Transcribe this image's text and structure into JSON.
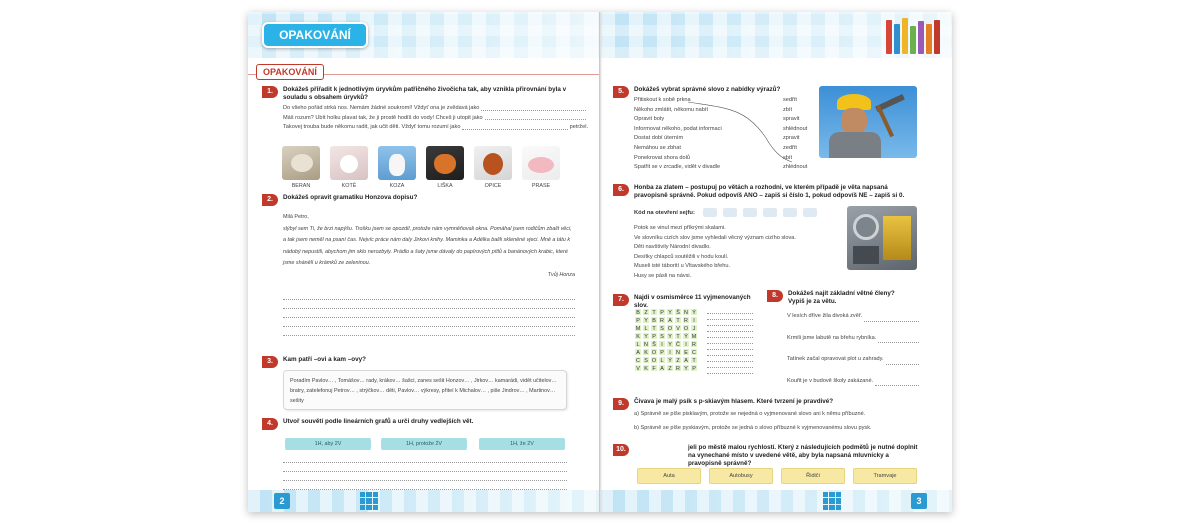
{
  "banner": {
    "title": "OPAKOVÁNÍ"
  },
  "left": {
    "section_tab": "OPAKOVÁNÍ",
    "page_number": "2",
    "q1": {
      "num": "1.",
      "text": "Dokážeš přiřadit k jednotlivým úryvkům patřičného živočicha tak, aby vznikla přirovnání byla v souladu s obsahem úryvků?",
      "sentences": [
        "Do všeho pořád strká nos. Nemám žádné soukromí! Vždyť ona je zvědavá jako",
        "Máš rozum? Ubít holku plavat tak, že ji prostě hodíš do vody! Chceš ji utopit jako",
        "Takovej trouba bude někomu radit, jak učit děti. Vždyť tomu rozumí jako"
      ],
      "sentence3_end": "petržel.",
      "animals": [
        "BERAN",
        "KOTĚ",
        "KOZA",
        "LIŠKA",
        "OPICE",
        "PRASE"
      ]
    },
    "q2": {
      "num": "2.",
      "text": "Dokážeš opravit gramatiku Honzova dopisu?",
      "greeting": "Milá Petro,",
      "letter": "slýbyl sem Ti, že brzi napýšu. Trošku jsem se opozdil, protože nám vymněňovali okna. Pomáhal jsem rodičům zbalit věci, a tak jsem neměl na psaní čas. Nejvíc práce nám daly Jirkovi knihy. Maminka a Adélka balili skleněné vjeci. Mně a tátu k nádobý nepustili, abychom jim sklo nerozbyly. Prádlo a šaty jsme dávaly do papírových pítlů a banánových krabic, které jsme shánělí u krámků ze zeleninou.",
      "signature": "Tvůj Honza"
    },
    "q3": {
      "num": "3.",
      "text": "Kam patří –ovi a kam –ovy?",
      "box": "Poradím Pavlov… , Tomášov… rady, krákov… šašci, zanes sešit Honzov… , Jirkov… kamarádi, vidět učitelov… bratry, zatelefonuj Petrov… , strýčkov… děti, Pavlov… výkresy, přiteí k Michalov… , piše Jindrov… , Martinov… sešity"
    },
    "q4": {
      "num": "4.",
      "text": "Utvoř souvětí podle lineárních grafů a urči druhy vedlejších vět.",
      "pills": [
        "1H, aby 2V",
        "1H, protože 2V",
        "1H, že 2V"
      ]
    }
  },
  "right": {
    "page_number": "3",
    "q5": {
      "num": "5.",
      "text": "Dokážeš vybrat správné slovo z nabídky výrazů?",
      "phrases": [
        "Přitiskout k sobě prkna",
        "Někoho zmlátit, někomu nabít",
        "Opravit boty",
        "Informovat někoho, podat informaci",
        "Dostat dobí úterním",
        "Nemáhou se zbhat",
        "Ponekrovat shora dolů",
        "Spatřit se v zrcadle, vidět v divadle"
      ],
      "words": [
        "sedřít",
        "zbít",
        "spravit",
        "shlédnout",
        "zpravit",
        "zedřít",
        "sbít",
        "zhlédnout"
      ]
    },
    "q6": {
      "num": "6.",
      "text": "Honba za zlatem – postupuj po větách a rozhodni, ve kterém případě je věta napsaná pravopisně správně. Pokud odpovíš ANO – zapiš si číslo 1, pokud odpovíš NE – zapiš si 0.",
      "code_label": "Kód na otevření sejfu:",
      "sentences": [
        "Potok se vinul mezi příkrými skalami.",
        "Ve slovníku cizích slov jsme vyhledali věcný význam cizího slova.",
        "Děti navštívily Národní divadlo.",
        "Desítky chlapců soutěžili v hodu koulí.",
        "Museli isté táborití u Vltavského břehu.",
        "Husy se pásli na návsi."
      ]
    },
    "q7": {
      "num": "7.",
      "text": "Najdi v osmisměrce 11 vyjmenovaných slov.",
      "grid": [
        [
          "B",
          "Z",
          "T",
          "P",
          "Y",
          "Š",
          "N",
          "Ý"
        ],
        [
          "P",
          "Y",
          "B",
          "R",
          "A",
          "T",
          "R",
          "I"
        ],
        [
          "M",
          "L",
          "T",
          "S",
          "O",
          "V",
          "O",
          "J"
        ],
        [
          "K",
          "Y",
          "P",
          "S",
          "Y",
          "T",
          "Ý",
          "M"
        ],
        [
          "L",
          "N",
          "Š",
          "I",
          "Y",
          "Č",
          "I",
          "R"
        ],
        [
          "A",
          "K",
          "O",
          "P",
          "I",
          "N",
          "E",
          "C"
        ],
        [
          "C",
          "S",
          "O",
          "L",
          "Ý",
          "Z",
          "A",
          "T"
        ],
        [
          "V",
          "K",
          "F",
          "A",
          "Z",
          "R",
          "Y",
          "P"
        ]
      ]
    },
    "q8": {
      "num": "8.",
      "text": "Dokážeš najít základní větné členy? Vypiš je za větu.",
      "sentences": [
        "V lesích dříve žila divoká zvěř.",
        "Krmili jsme labutě na břehu rybníka.",
        "Tatínek začal opravovat plot u zahrady.",
        "Kouřit je v budově školy zakázané."
      ]
    },
    "q9": {
      "num": "9.",
      "text": "Čivava je malý psík s p-skiavým hlasem. Které tvrzení je pravdivé?",
      "options": [
        "a) Správně se píše pisklavým, protože se nejedná o vyjmenované slovo ani k němu příbuzné.",
        "b) Správně se píše pyskiavým, protože se jedná o slovo příbuzné k vyjmenovanému slovu pysk."
      ]
    },
    "q10": {
      "num": "10.",
      "text": "jeli po městě malou rychlostí. Který z následujících podmětů je nutné doplnit na vynechané místo v uvedené větě, aby byla napsaná mluvnicky a pravopisně správně?",
      "options": [
        "Auta",
        "Autobusy",
        "Řidiči",
        "Tramvaje"
      ]
    }
  },
  "colors": {
    "accent_red": "#c0392b",
    "banner_blue": "#2bb2e6",
    "pill_teal": "#a5dfe4",
    "option_yellow": "#f7e9a3"
  }
}
